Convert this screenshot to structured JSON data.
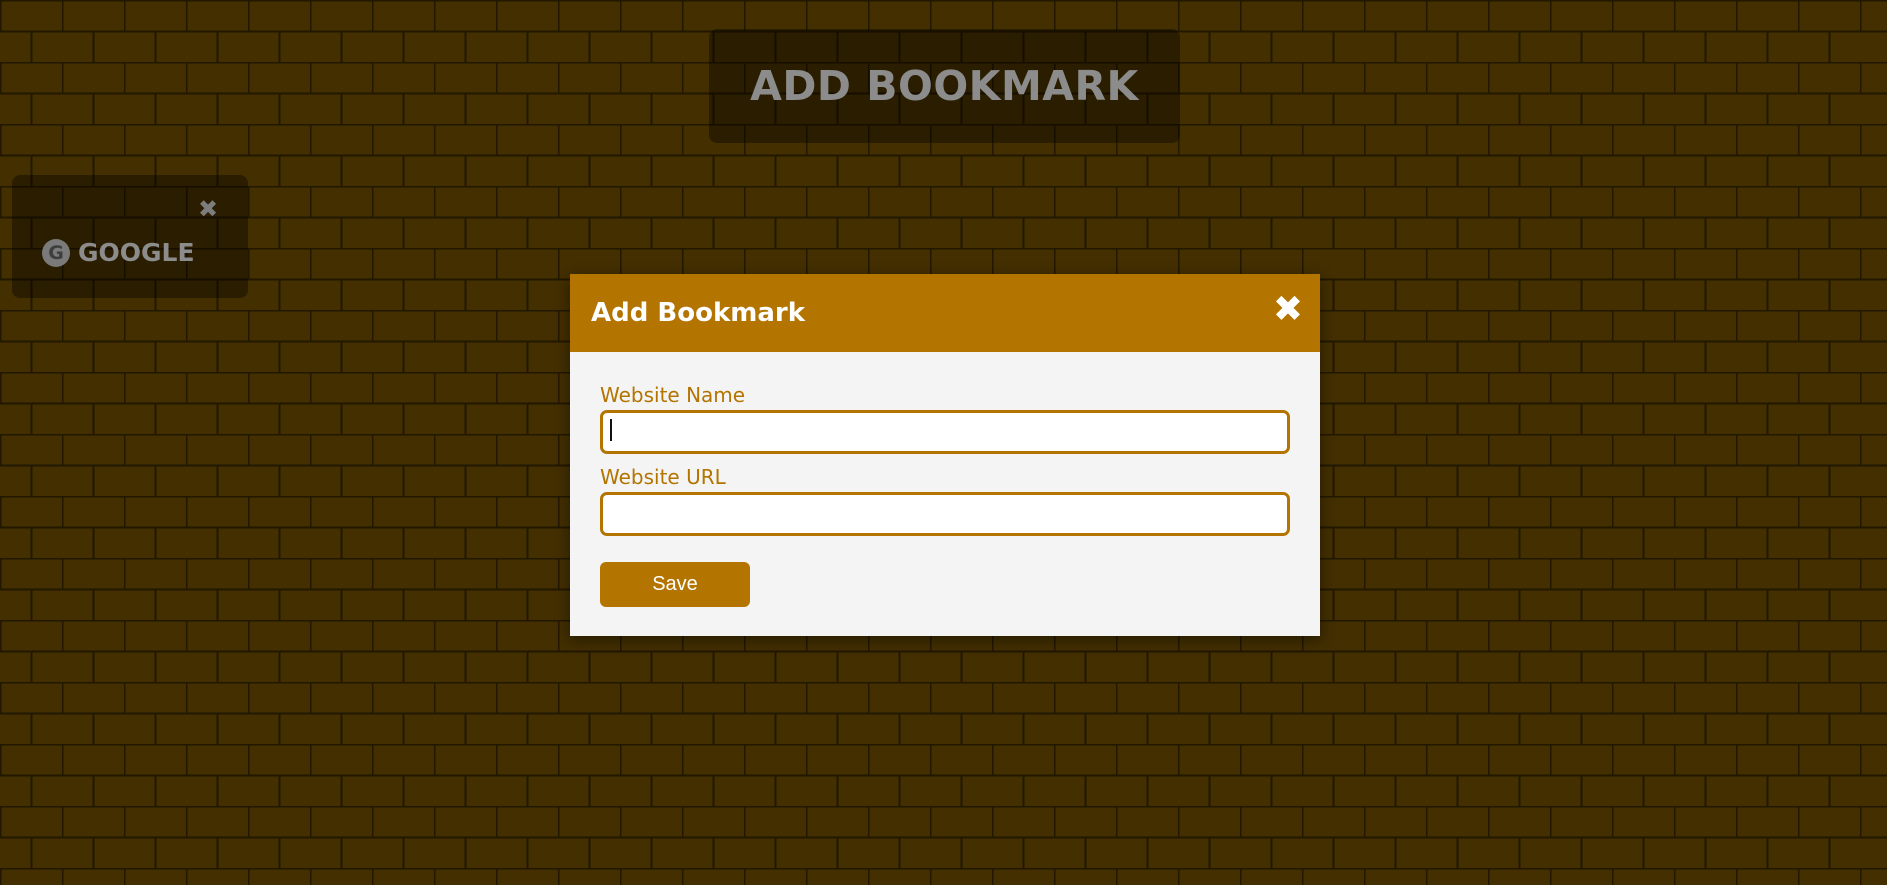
{
  "page": {
    "header_button_label": "ADD BOOKMARK"
  },
  "bookmarks": [
    {
      "name": "GOOGLE",
      "favicon_letter": "G",
      "close_symbol": "✖",
      "icon": "google-favicon-icon"
    }
  ],
  "modal": {
    "title": "Add Bookmark",
    "close_symbol": "✖",
    "fields": [
      {
        "label": "Website Name",
        "value": "",
        "placeholder": ""
      },
      {
        "label": "Website URL",
        "value": "",
        "placeholder": ""
      }
    ],
    "save_label": "Save"
  },
  "colors": {
    "accent": "#b37400",
    "modal_background": "#f4f4f4",
    "page_background": "#5a3f00"
  }
}
